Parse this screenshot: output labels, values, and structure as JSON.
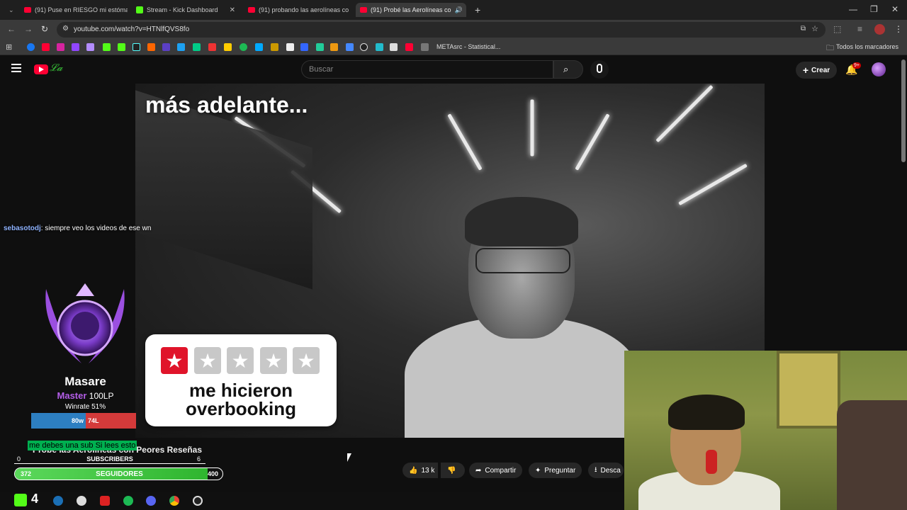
{
  "browser": {
    "tabs": [
      {
        "label": "(91) Puse en RIESGO mi estómago",
        "type": "yt"
      },
      {
        "label": "Stream - Kick Dashboard",
        "type": "kick"
      },
      {
        "label": "(91) probando las aerolíneas co",
        "type": "yt"
      },
      {
        "label": "(91) Probé las Aerolíneas co",
        "type": "yt",
        "active": true
      }
    ],
    "url": "youtube.com/watch?v=HTNlfQVS8fo",
    "bookmarks": {
      "meta_label": "METAsrc - Statistical...",
      "all_label": "Todos los marcadores"
    }
  },
  "youtube": {
    "search_placeholder": "Buscar",
    "create_label": "Crear",
    "notif_badge": "9+",
    "video_overlay_text": "más adelante...",
    "rating_text_line1": "me hicieron",
    "rating_text_line2": "overbooking",
    "video_title": "Probé las Aerolíneas con Peores Reseñas",
    "likes": "13 k",
    "share_label": "Compartir",
    "ask_label": "Preguntar",
    "download_label": "Desca"
  },
  "stream_overlay": {
    "chat": {
      "user": "sebasotodj",
      "message": ": siempre veo los videos de ese wn"
    },
    "rank": {
      "name": "Masare",
      "tier": "Master",
      "lp": "100LP",
      "winrate": "Winrate 51%",
      "wins": "80w",
      "losses": "74L",
      "win_fraction": 0.52
    },
    "sub_ticker": "me debes una sub Si lees esto",
    "subs": {
      "current": "0",
      "label": "SUBSCRIBERS",
      "goal": "6"
    },
    "followers": {
      "current": "372",
      "label": "SEGUIDORES",
      "goal": "400",
      "fill_fraction": 0.93
    },
    "taskbar_badge": "4"
  },
  "colors": {
    "yt_red": "#ff0033",
    "kick_green": "#53fc18",
    "star_red": "#e0142a",
    "master_purple": "#b45ee8"
  }
}
